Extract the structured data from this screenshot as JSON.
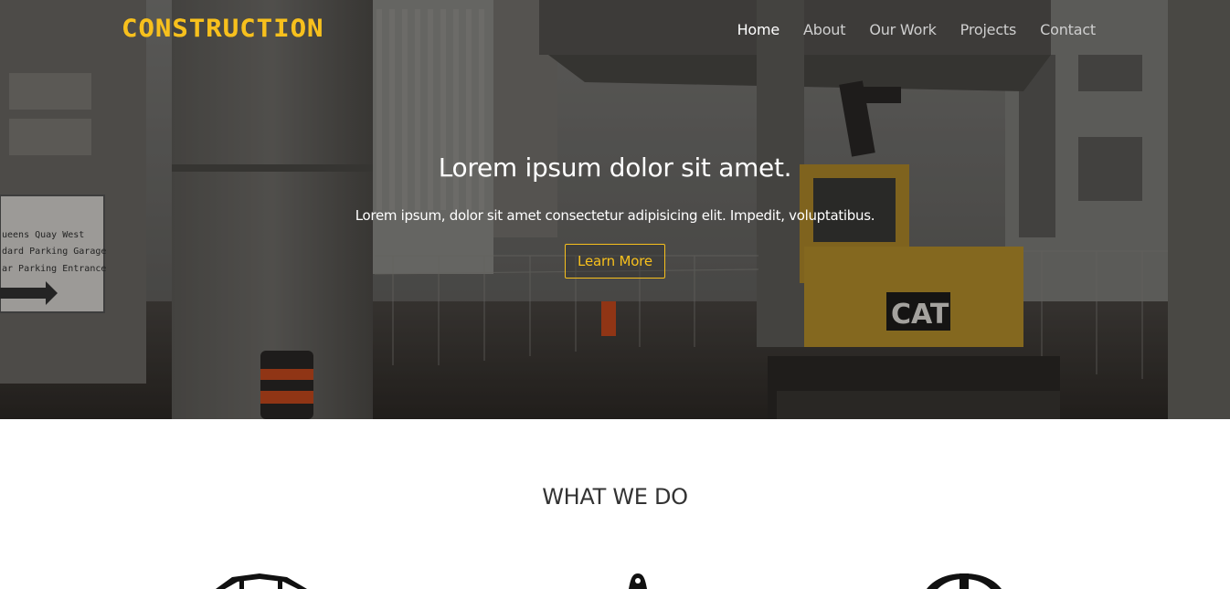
{
  "brand": {
    "logo_text": "CONSTRUCTION",
    "accent_color": "#f7c01d"
  },
  "nav": {
    "items": [
      {
        "label": "Home",
        "active": true
      },
      {
        "label": "About",
        "active": false
      },
      {
        "label": "Our Work",
        "active": false
      },
      {
        "label": "Projects",
        "active": false
      },
      {
        "label": "Contact",
        "active": false
      }
    ]
  },
  "hero": {
    "title": "Lorem ipsum dolor sit amet.",
    "subtitle": "Lorem ipsum, dolor sit amet consectetur adipisicing elit. Impedit, voluptatibus.",
    "button_label": "Learn More",
    "background_image": "construction-site-excavator-photo",
    "sign_lines": [
      "ueens Quay West",
      "dard Parking Garage",
      "ar Parking Entrance"
    ],
    "machine_label": "CAT"
  },
  "services": {
    "title": "WHAT WE DO",
    "icons": [
      "crane-structure-icon",
      "plumb-bob-icon",
      "hard-hat-icon"
    ]
  }
}
